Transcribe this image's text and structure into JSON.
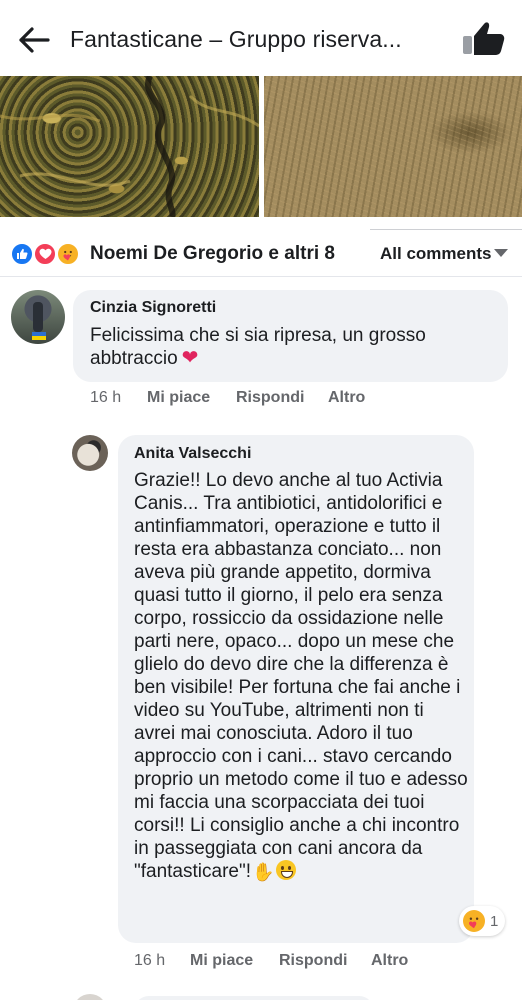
{
  "header": {
    "title": "Fantasticane – Gruppo riserva...",
    "back_icon": "arrow-left-icon",
    "like_icon": "thumbs-up-icon"
  },
  "reactions": {
    "icons": [
      "like-reaction-icon",
      "love-reaction-icon",
      "care-reaction-icon"
    ],
    "summary": "Noemi De Gregorio e altri 8",
    "filter_label": "All comments"
  },
  "comments": [
    {
      "author": "Cinzia Signoretti",
      "text": "Felicissima che si sia ripresa, un grosso abbtraccio",
      "time": "16 h",
      "like": "Mi piace",
      "reply": "Rispondi",
      "more": "Altro"
    },
    {
      "author": "Anita Valsecchi",
      "text": "Grazie!! Lo devo anche al tuo Activia Canis... Tra antibiotici, antidolorifici e antinfiammatori, operazione e tutto il resta era abbastanza conciato... non aveva più grande appetito, dormiva quasi tutto il giorno, il pelo era senza corpo, rossiccio da ossidazione nelle parti nere, opaco... dopo un mese che glielo do devo dire che la differenza è ben visibile! Per fortuna che fai anche i video su YouTube, altrimenti non ti avrei mai conosciuta. Adoro il tuo approccio con i cani... stavo cercando proprio un metodo come il tuo e adesso mi faccia una scorpacciata dei tuoi corsi!! Li consiglio anche a chi incontro in passeggiata con cani ancora da \"fantasticare\"!",
      "reaction_count": "1",
      "time": "16 h",
      "like": "Mi piace",
      "reply": "Rispondi",
      "more": "Altro"
    }
  ],
  "colors": {
    "like_blue": "#1877f2",
    "love_red": "#f33e58",
    "care_yellow": "#f7b125",
    "bubble_gray": "#f0f2f5",
    "meta_gray": "#65676b"
  }
}
